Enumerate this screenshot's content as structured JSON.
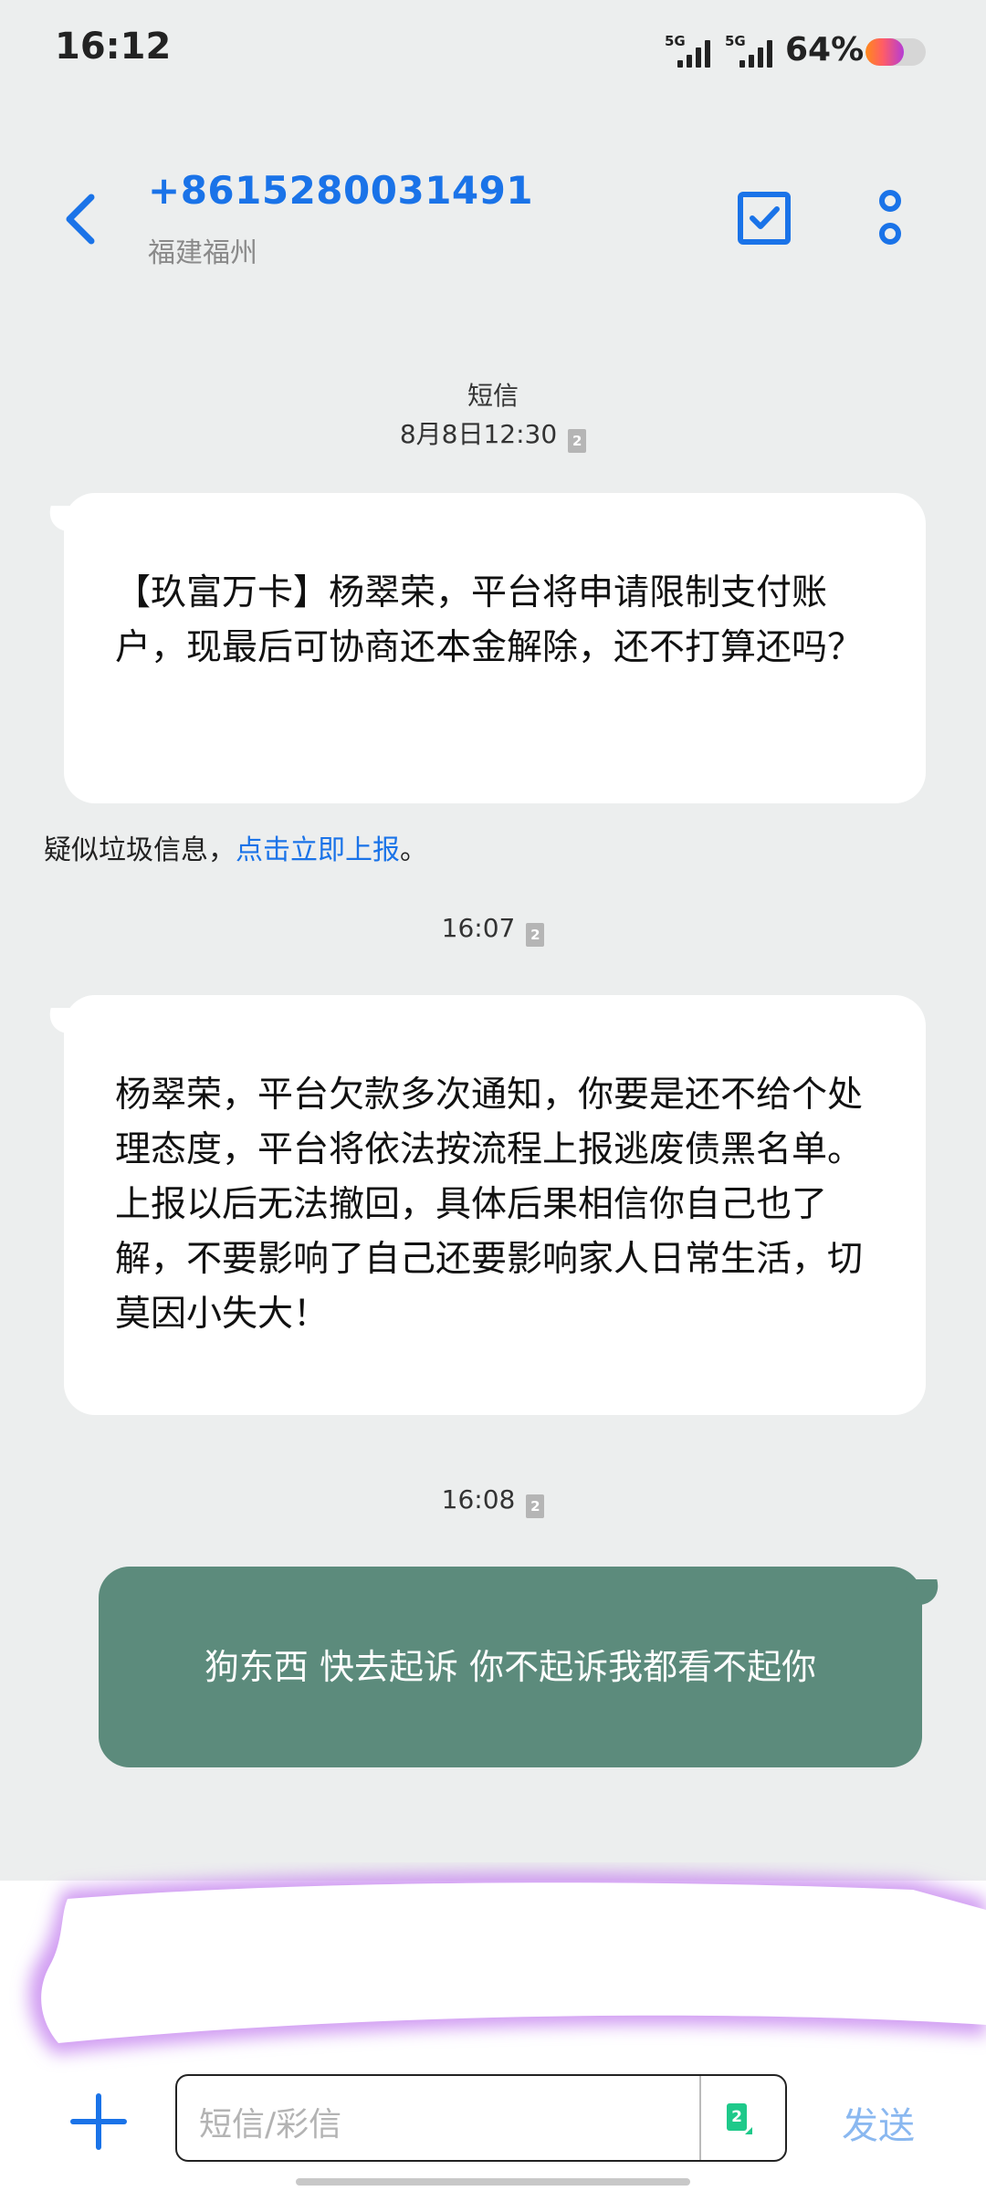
{
  "status_bar": {
    "time": "16:12",
    "network_1": "5G",
    "network_2": "5G",
    "battery_percent": "64%",
    "battery_level": 0.64
  },
  "header": {
    "contact_number": "+8615280031491",
    "contact_location": "福建福州",
    "back_icon": "chevron-left-icon",
    "select_icon": "checkbox-icon",
    "more_icon": "more-vertical-icon"
  },
  "conversation": {
    "first_stamp": {
      "label": "短信",
      "time": "8月8日12:30",
      "sim": "2"
    },
    "messages": [
      {
        "direction": "incoming",
        "text": "【玖富万卡】杨翠荣，平台将申请限制支付账户，现最后可协商还本金解除，还不打算还吗？"
      },
      {
        "direction": "incoming",
        "text": "杨翠荣，平台欠款多次通知，你要是还不给个处理态度，平台将依法按流程上报逃废债黑名单。上报以后无法撤回，具体后果相信你自己也了解，不要影响了自己还要影响家人日常生活，切莫因小失大！"
      },
      {
        "direction": "outgoing",
        "text": "狗东西 快去起诉 你不起诉我都看不起你"
      }
    ],
    "spam_warning": {
      "prefix": "疑似垃圾信息，",
      "link": "点击立即上报",
      "suffix": "。"
    },
    "stamp_2": {
      "time": "16:07",
      "sim": "2"
    },
    "stamp_3": {
      "time": "16:08",
      "sim": "2"
    }
  },
  "composer": {
    "placeholder": "短信/彩信",
    "sim": "2",
    "send_label": "发送",
    "add_icon": "plus-icon"
  },
  "colors": {
    "accent": "#1a73e8",
    "outgoing_bubble": "#5c8b7c",
    "background": "#eceeee"
  }
}
